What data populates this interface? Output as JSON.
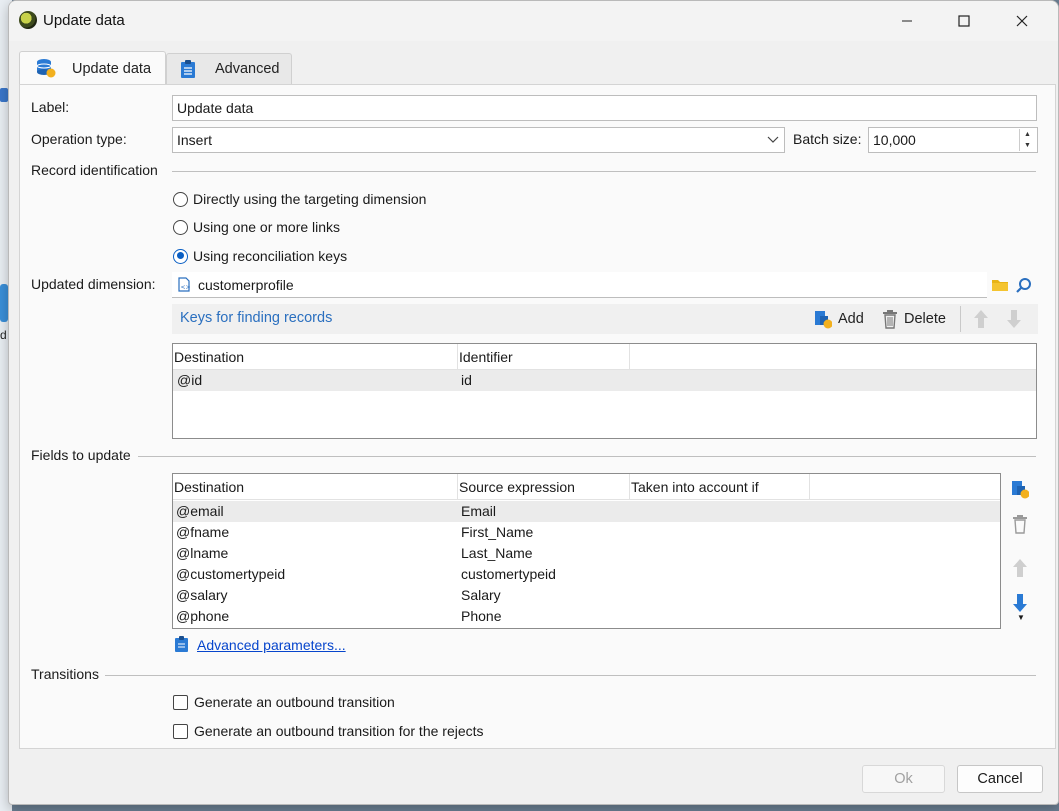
{
  "window": {
    "title": "Update data"
  },
  "tabs": [
    {
      "label": "Update data",
      "active": true,
      "icon": "database-refresh-icon"
    },
    {
      "label": "Advanced",
      "active": false,
      "icon": "clipboard-icon"
    }
  ],
  "form": {
    "label_caption": "Label:",
    "label_value": "Update data",
    "operation_type_caption": "Operation type:",
    "operation_type_value": "Insert",
    "batch_size_caption": "Batch size:",
    "batch_size_value": "10,000"
  },
  "record_identification": {
    "heading": "Record identification",
    "options": [
      {
        "label": "Directly using the targeting dimension",
        "selected": false
      },
      {
        "label": "Using one or more links",
        "selected": false
      },
      {
        "label": "Using reconciliation keys",
        "selected": true
      }
    ],
    "updated_dimension_caption": "Updated dimension:",
    "updated_dimension_value": "customerprofile"
  },
  "keys": {
    "title": "Keys for finding records",
    "add_label": "Add",
    "delete_label": "Delete",
    "columns": [
      "Destination",
      "Identifier"
    ],
    "rows": [
      {
        "destination": "@id",
        "identifier": "id"
      }
    ]
  },
  "fields": {
    "heading": "Fields to update",
    "columns": [
      "Destination",
      "Source expression",
      "Taken into account if"
    ],
    "rows": [
      {
        "destination": "@email",
        "source": "Email",
        "condition": ""
      },
      {
        "destination": "@fname",
        "source": "First_Name",
        "condition": ""
      },
      {
        "destination": "@lname",
        "source": "Last_Name",
        "condition": ""
      },
      {
        "destination": "@customertypeid",
        "source": "customertypeid",
        "condition": ""
      },
      {
        "destination": "@salary",
        "source": "Salary",
        "condition": ""
      },
      {
        "destination": "@phone",
        "source": "Phone",
        "condition": ""
      }
    ],
    "advanced_link": "Advanced parameters..."
  },
  "transitions": {
    "heading": "Transitions",
    "options": [
      {
        "label": "Generate an outbound transition",
        "checked": false
      },
      {
        "label": "Generate an outbound transition for the rejects",
        "checked": false
      }
    ]
  },
  "footer": {
    "ok_label": "Ok",
    "cancel_label": "Cancel"
  },
  "colors": {
    "accent": "#0a5fc4",
    "link": "#2a6fbf",
    "folder": "#e8b416"
  }
}
